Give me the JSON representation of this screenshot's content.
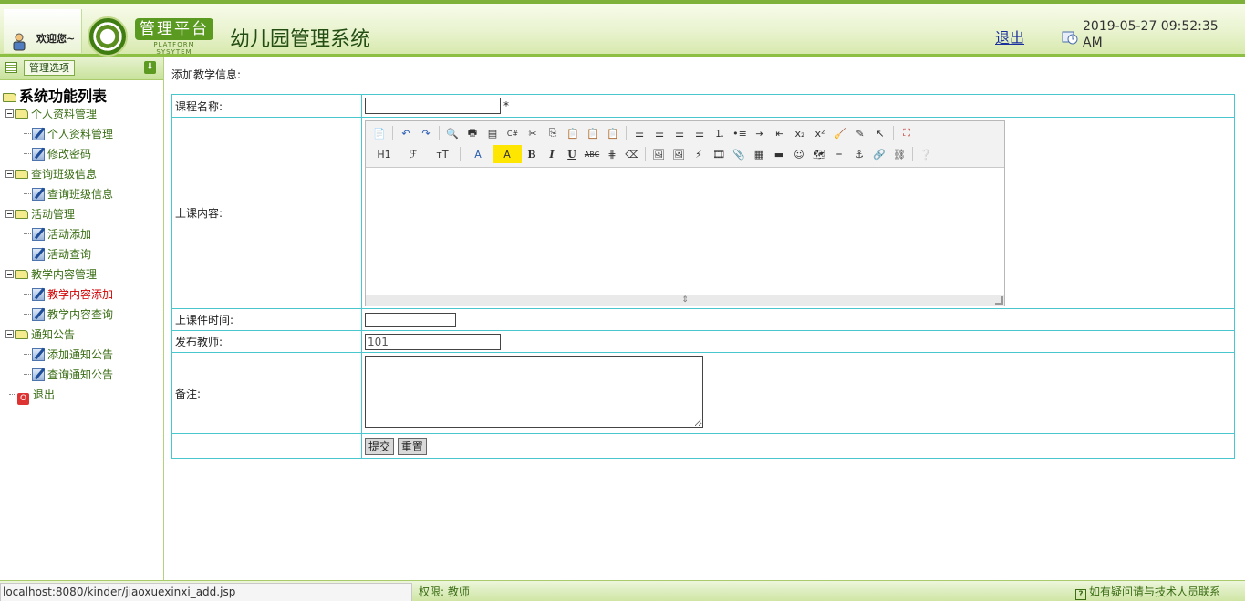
{
  "header": {
    "welcome": "欢迎您~",
    "platform_cn": "管理平台",
    "platform_en": "PLATFORM SYSYTEM",
    "system_title": "幼儿园管理系统",
    "logout": "退出",
    "datetime": "2019-05-27 09:52:35 AM"
  },
  "sidebar": {
    "tab_label": "管理选项",
    "root": "系统功能列表",
    "groups": [
      {
        "label": "个人资料管理",
        "items": [
          "个人资料管理",
          "修改密码"
        ]
      },
      {
        "label": "查询班级信息",
        "items": [
          "查询班级信息"
        ]
      },
      {
        "label": "活动管理",
        "items": [
          "活动添加",
          "活动查询"
        ]
      },
      {
        "label": "教学内容管理",
        "items": [
          "教学内容添加",
          "教学内容查询"
        ]
      },
      {
        "label": "通知公告",
        "items": [
          "添加通知公告",
          "查询通知公告"
        ]
      }
    ],
    "exit": "退出"
  },
  "main": {
    "heading": "添加教学信息:",
    "fields": {
      "course_name_label": "课程名称:",
      "course_name_value": "",
      "required_mark": "*",
      "content_label": "上课内容:",
      "time_label": "上课件时间:",
      "time_value": "",
      "teacher_label": "发布教师:",
      "teacher_value": "101",
      "note_label": "备注:"
    },
    "editor": {
      "heading_btn": "H1",
      "font_btn": "ℱ",
      "size_btn": "тT",
      "fontcolor_btn": "A",
      "bgcolor_btn": "A",
      "bold_btn": "B",
      "italic_btn": "I",
      "underline_btn": "U",
      "strike_btn": "ABC"
    },
    "buttons": {
      "submit": "提交",
      "reset": "重置"
    }
  },
  "footer": {
    "url": "localhost:8080/kinder/jiaoxuexinxi_add.jsp",
    "permission": "权限:  教师",
    "help_icon": "?",
    "help": "如有疑问请与技术人员联系"
  }
}
